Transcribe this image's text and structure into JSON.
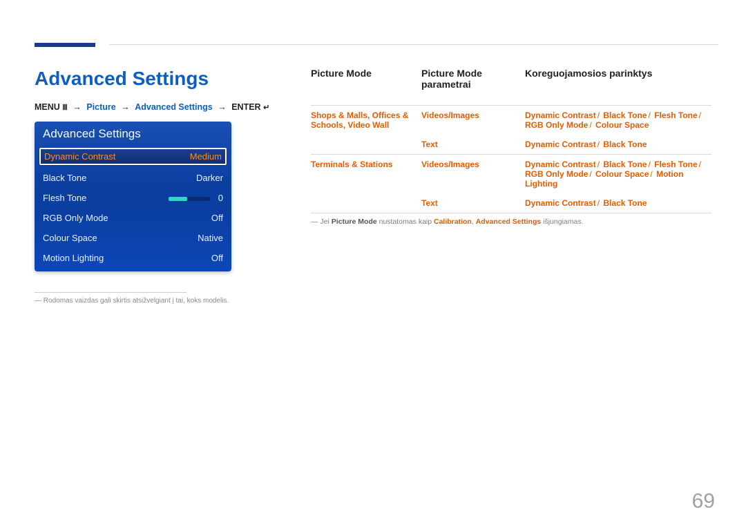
{
  "page_number": "69",
  "title": "Advanced Settings",
  "breadcrumb": {
    "menu": "MENU",
    "picture": "Picture",
    "advanced": "Advanced Settings",
    "enter": "ENTER"
  },
  "osd": {
    "header": "Advanced Settings",
    "rows": [
      {
        "label": "Dynamic Contrast",
        "value": "Medium",
        "selected": true
      },
      {
        "label": "Black Tone",
        "value": "Darker"
      },
      {
        "label": "Flesh Tone",
        "value": "0",
        "slider": true
      },
      {
        "label": "RGB Only Mode",
        "value": "Off"
      },
      {
        "label": "Colour Space",
        "value": "Native"
      },
      {
        "label": "Motion Lighting",
        "value": "Off"
      }
    ]
  },
  "left_footnote": "Rodomas vaizdas gali skirtis atsižvelgiant į tai, koks modelis.",
  "table": {
    "headers": {
      "c1": "Picture Mode",
      "c2": "Picture Mode parametrai",
      "c3": "Koreguojamosios parinktys"
    },
    "groups": [
      {
        "c1": "Shops & Malls, Offices & Schools, Video Wall",
        "rows": [
          {
            "c2": "Videos/Images",
            "c3": [
              "Dynamic Contrast",
              "Black Tone",
              "Flesh Tone",
              "RGB Only Mode",
              "Colour Space"
            ]
          },
          {
            "c2": "Text",
            "c3": [
              "Dynamic Contrast",
              "Black Tone"
            ]
          }
        ]
      },
      {
        "c1": "Terminals & Stations",
        "rows": [
          {
            "c2": "Videos/Images",
            "c3": [
              "Dynamic Contrast",
              "Black Tone",
              "Flesh Tone",
              "RGB Only Mode",
              "Colour Space",
              "Motion Lighting"
            ]
          },
          {
            "c2": "Text",
            "c3": [
              "Dynamic Contrast",
              "Black Tone"
            ]
          }
        ]
      }
    ]
  },
  "note": {
    "pre": "Jei ",
    "b1": "Picture Mode",
    "mid": " nustatomas kaip ",
    "o1": "Calibration",
    "sep": ", ",
    "o2": "Advanced Settings",
    "post": " išjungiamas."
  }
}
